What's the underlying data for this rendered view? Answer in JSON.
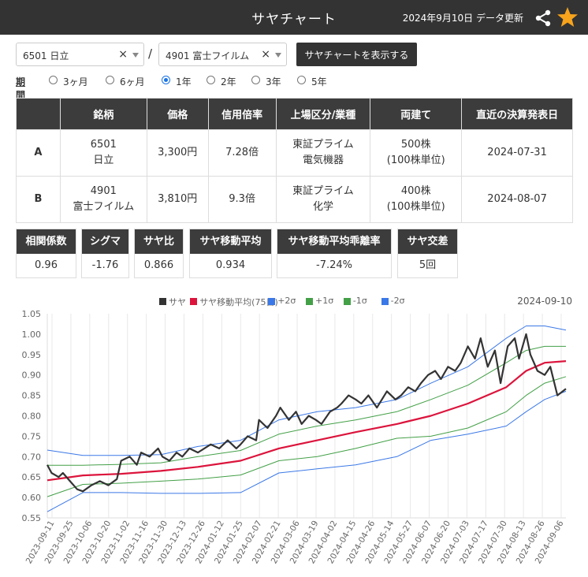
{
  "header": {
    "title": "サヤチャート",
    "updated": "2024年9月10日 データ更新",
    "share_icon": "share-icon",
    "favorite_icon": "star-icon",
    "accent": "#f7a31c"
  },
  "controls": {
    "stock_a": "6501 日立",
    "stock_b": "4901 富士フイルム",
    "clear_glyph": "×",
    "separator": "/",
    "show_button": "サヤチャートを表示する",
    "period_label": "期間",
    "periods": [
      "3ヶ月",
      "6ヶ月",
      "1年",
      "2年",
      "3年",
      "5年"
    ],
    "selected_period": "1年"
  },
  "info_table": {
    "headers": [
      "",
      "銘柄",
      "価格",
      "信用倍率",
      "上場区分/業種",
      "両建て",
      "直近の決算発表日"
    ],
    "rows": [
      {
        "id": "A",
        "code": "6501",
        "name": "日立",
        "price": "3,300円",
        "margin": "7.28倍",
        "market": "東証プライム",
        "sector": "電気機器",
        "shares": "500株",
        "unit": "(100株単位)",
        "earnings": "2024-07-31"
      },
      {
        "id": "B",
        "code": "4901",
        "name": "富士フイルム",
        "price": "3,810円",
        "margin": "9.3倍",
        "market": "東証プライム",
        "sector": "化学",
        "shares": "400株",
        "unit": "(100株単位)",
        "earnings": "2024-08-07"
      }
    ]
  },
  "stats": [
    {
      "label": "相関係数",
      "value": "0.96"
    },
    {
      "label": "シグマ",
      "value": "-1.76"
    },
    {
      "label": "サヤ比",
      "value": "0.866"
    },
    {
      "label": "サヤ移動平均",
      "value": "0.934"
    },
    {
      "label": "サヤ移動平均乖離率",
      "value": "-7.24%"
    },
    {
      "label": "サヤ交差",
      "value": "5回"
    }
  ],
  "chart_data": {
    "type": "line",
    "date_label": "2024-09-10",
    "ylim": [
      0.55,
      1.05
    ],
    "y_ticks": [
      "1.05",
      "1.00",
      "0.95",
      "0.90",
      "0.85",
      "0.80",
      "0.75",
      "0.70",
      "0.65",
      "0.60",
      "0.55"
    ],
    "x_ticks": [
      "2023-09-11",
      "2023-09-25",
      "2023-10-06",
      "2023-10-20",
      "2023-11-02",
      "2023-11-16",
      "2023-11-30",
      "2023-12-13",
      "2023-12-26",
      "2024-01-12",
      "2024-01-25",
      "2024-02-07",
      "2024-02-21",
      "2024-03-06",
      "2024-03-19",
      "2024-04-02",
      "2024-04-15",
      "2024-04-26",
      "2024-05-14",
      "2024-05-27",
      "2024-06-07",
      "2024-06-20",
      "2024-07-03",
      "2024-07-17",
      "2024-07-30",
      "2024-08-13",
      "2024-08-26",
      "2024-09-06"
    ],
    "x_start": "2023-09-11",
    "x_end": "2024-09-10",
    "grid": "vertical",
    "legend_position": "top",
    "series": [
      {
        "name": "サヤ",
        "color": "#333333",
        "width": 2.2,
        "x": [
          "2023-09-11",
          "2023-09-14",
          "2023-09-19",
          "2023-09-22",
          "2023-09-27",
          "2023-10-02",
          "2023-10-06",
          "2023-10-12",
          "2023-10-18",
          "2023-10-24",
          "2023-10-30",
          "2023-11-02",
          "2023-11-08",
          "2023-11-13",
          "2023-11-16",
          "2023-11-22",
          "2023-11-28",
          "2023-12-01",
          "2023-12-06",
          "2023-12-11",
          "2023-12-15",
          "2023-12-20",
          "2023-12-26",
          "2024-01-04",
          "2024-01-10",
          "2024-01-16",
          "2024-01-22",
          "2024-01-25",
          "2024-01-30",
          "2024-02-05",
          "2024-02-07",
          "2024-02-13",
          "2024-02-19",
          "2024-02-22",
          "2024-02-28",
          "2024-03-04",
          "2024-03-08",
          "2024-03-13",
          "2024-03-18",
          "2024-03-22",
          "2024-03-28",
          "2024-04-02",
          "2024-04-05",
          "2024-04-10",
          "2024-04-15",
          "2024-04-19",
          "2024-04-24",
          "2024-04-30",
          "2024-05-07",
          "2024-05-13",
          "2024-05-17",
          "2024-05-22",
          "2024-05-27",
          "2024-05-31",
          "2024-06-05",
          "2024-06-10",
          "2024-06-14",
          "2024-06-19",
          "2024-06-24",
          "2024-06-28",
          "2024-07-03",
          "2024-07-08",
          "2024-07-12",
          "2024-07-17",
          "2024-07-22",
          "2024-07-26",
          "2024-07-31",
          "2024-08-05",
          "2024-08-08",
          "2024-08-13",
          "2024-08-16",
          "2024-08-21",
          "2024-08-26",
          "2024-08-30",
          "2024-09-04",
          "2024-09-10"
        ],
        "y": [
          0.68,
          0.66,
          0.65,
          0.66,
          0.64,
          0.62,
          0.615,
          0.63,
          0.64,
          0.63,
          0.645,
          0.69,
          0.7,
          0.68,
          0.71,
          0.7,
          0.72,
          0.7,
          0.69,
          0.71,
          0.7,
          0.72,
          0.71,
          0.73,
          0.72,
          0.74,
          0.72,
          0.73,
          0.75,
          0.74,
          0.79,
          0.77,
          0.8,
          0.82,
          0.79,
          0.81,
          0.78,
          0.8,
          0.79,
          0.78,
          0.81,
          0.82,
          0.83,
          0.85,
          0.84,
          0.83,
          0.85,
          0.82,
          0.86,
          0.84,
          0.85,
          0.87,
          0.86,
          0.88,
          0.9,
          0.91,
          0.89,
          0.92,
          0.91,
          0.93,
          0.97,
          0.94,
          0.99,
          0.92,
          0.96,
          0.88,
          0.97,
          0.99,
          0.94,
          1.0,
          0.95,
          0.91,
          0.9,
          0.92,
          0.85,
          0.866
        ]
      },
      {
        "name": "サヤ移動平均(75日)",
        "color": "#dc143c",
        "width": 2.2,
        "x": [
          "2023-09-11",
          "2023-10-06",
          "2023-11-02",
          "2023-11-30",
          "2023-12-26",
          "2024-01-25",
          "2024-02-21",
          "2024-03-19",
          "2024-04-15",
          "2024-05-14",
          "2024-06-07",
          "2024-07-03",
          "2024-07-30",
          "2024-08-13",
          "2024-08-26",
          "2024-09-10"
        ],
        "y": [
          0.642,
          0.654,
          0.658,
          0.665,
          0.675,
          0.69,
          0.72,
          0.74,
          0.76,
          0.78,
          0.8,
          0.83,
          0.87,
          0.91,
          0.93,
          0.934
        ]
      },
      {
        "name": "+2σ",
        "color": "#3b78e7",
        "width": 1,
        "x": [
          "2023-09-11",
          "2023-10-06",
          "2023-11-02",
          "2023-11-30",
          "2023-12-26",
          "2024-01-25",
          "2024-02-21",
          "2024-03-19",
          "2024-04-15",
          "2024-05-14",
          "2024-06-07",
          "2024-07-03",
          "2024-07-30",
          "2024-08-13",
          "2024-08-26",
          "2024-09-10"
        ],
        "y": [
          0.716,
          0.703,
          0.703,
          0.705,
          0.725,
          0.74,
          0.79,
          0.81,
          0.82,
          0.84,
          0.88,
          0.92,
          0.99,
          1.02,
          1.02,
          1.01
        ]
      },
      {
        "name": "+1σ",
        "color": "#43a047",
        "width": 1,
        "x": [
          "2023-09-11",
          "2023-10-06",
          "2023-11-02",
          "2023-11-30",
          "2023-12-26",
          "2024-01-25",
          "2024-02-21",
          "2024-03-19",
          "2024-04-15",
          "2024-05-14",
          "2024-06-07",
          "2024-07-03",
          "2024-07-30",
          "2024-08-13",
          "2024-08-26",
          "2024-09-10"
        ],
        "y": [
          0.679,
          0.679,
          0.681,
          0.685,
          0.7,
          0.715,
          0.755,
          0.775,
          0.79,
          0.81,
          0.84,
          0.875,
          0.93,
          0.96,
          0.97,
          0.97
        ]
      },
      {
        "name": "-1σ",
        "color": "#43a047",
        "width": 1,
        "x": [
          "2023-09-11",
          "2023-10-06",
          "2023-11-02",
          "2023-11-30",
          "2023-12-26",
          "2024-01-25",
          "2024-02-21",
          "2024-03-19",
          "2024-04-15",
          "2024-05-14",
          "2024-06-07",
          "2024-07-03",
          "2024-07-30",
          "2024-08-13",
          "2024-08-26",
          "2024-09-10"
        ],
        "y": [
          0.602,
          0.632,
          0.635,
          0.64,
          0.645,
          0.655,
          0.69,
          0.7,
          0.72,
          0.745,
          0.75,
          0.77,
          0.81,
          0.85,
          0.88,
          0.896
        ]
      },
      {
        "name": "-2σ",
        "color": "#3b78e7",
        "width": 1,
        "x": [
          "2023-09-11",
          "2023-10-06",
          "2023-11-02",
          "2023-11-30",
          "2023-12-26",
          "2024-01-25",
          "2024-02-21",
          "2024-03-19",
          "2024-04-15",
          "2024-05-14",
          "2024-06-07",
          "2024-07-03",
          "2024-07-30",
          "2024-08-13",
          "2024-08-26",
          "2024-09-10"
        ],
        "y": [
          0.565,
          0.612,
          0.612,
          0.61,
          0.61,
          0.612,
          0.66,
          0.67,
          0.68,
          0.7,
          0.74,
          0.755,
          0.775,
          0.81,
          0.84,
          0.86
        ]
      }
    ]
  }
}
